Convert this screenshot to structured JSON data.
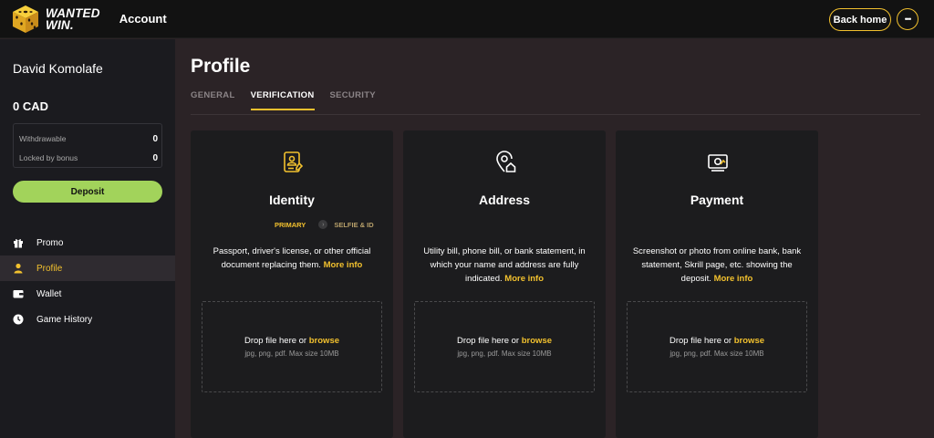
{
  "brand": {
    "name_line1": "WANTED",
    "name_line2": "WIN."
  },
  "header": {
    "title": "Account",
    "back_home": "Back home",
    "more": "•••"
  },
  "sidebar": {
    "username": "David Komolafe",
    "balance": "0 CAD",
    "withdrawable_label": "Withdrawable",
    "withdrawable_value": "0",
    "locked_label": "Locked by bonus",
    "locked_value": "0",
    "deposit": "Deposit",
    "items": [
      {
        "label": "Promo",
        "icon": "gift-icon"
      },
      {
        "label": "Profile",
        "icon": "user-icon"
      },
      {
        "label": "Wallet",
        "icon": "wallet-icon"
      },
      {
        "label": "Game History",
        "icon": "clock-icon"
      }
    ]
  },
  "main": {
    "title": "Profile",
    "tabs": [
      {
        "label": "GENERAL"
      },
      {
        "label": "VERIFICATION"
      },
      {
        "label": "SECURITY"
      }
    ],
    "active_tab": "VERIFICATION",
    "cards": [
      {
        "title": "Identity",
        "icon": "id-card-icon",
        "step1": "PRIMARY",
        "step2": "SELFIE & ID",
        "desc": "Passport, driver's license, or other official document replacing them.",
        "more": "More info",
        "drop_text": "Drop file here or",
        "browse": "browse",
        "hint": "jpg, png, pdf. Max size 10MB"
      },
      {
        "title": "Address",
        "icon": "location-home-icon",
        "desc": "Utility bill, phone bill, or bank statement, in which your name and address are fully indicated.",
        "more": "More info",
        "drop_text": "Drop file here or",
        "browse": "browse",
        "hint": "jpg, png, pdf. Max size 10MB"
      },
      {
        "title": "Payment",
        "icon": "payment-card-icon",
        "desc": "Screenshot or photo from online bank, bank statement, Skrill page, etc. showing the deposit.",
        "more": "More info",
        "drop_text": "Drop file here or",
        "browse": "browse",
        "hint": "jpg, png, pdf. Max size 10MB"
      }
    ]
  },
  "colors": {
    "accent": "#f2c12e",
    "deposit": "#a2d35b",
    "bg": "#2b2326",
    "sidebar": "#1b1b1f",
    "card": "#1c1c1e"
  }
}
